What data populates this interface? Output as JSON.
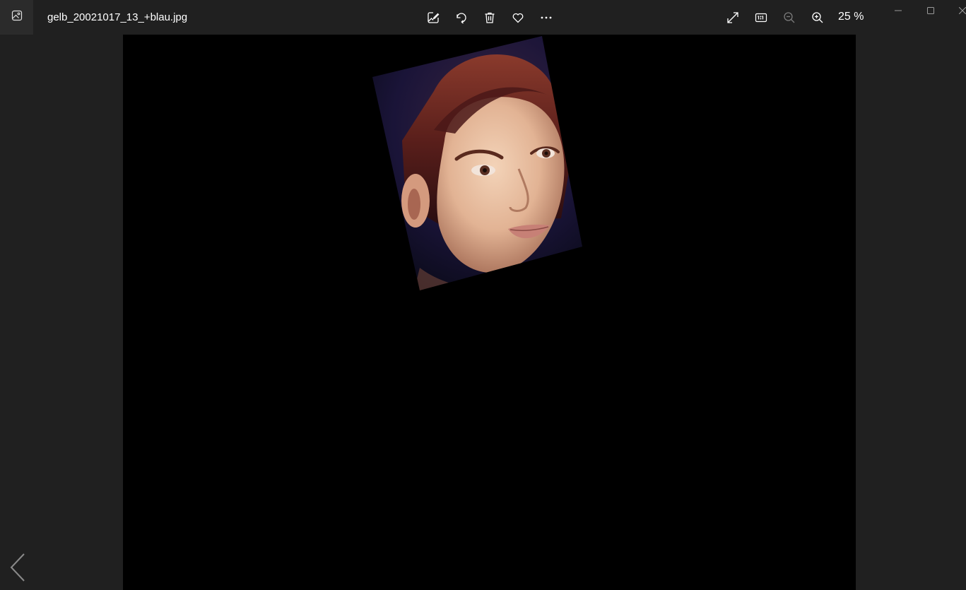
{
  "window": {
    "file_name": "gelb_20021017_13_+blau.jpg",
    "zoom_level": "25 %"
  },
  "toolbar": {
    "icons": [
      "edit-image-icon",
      "rotate-icon",
      "delete-icon",
      "favorite-icon",
      "more-icon"
    ]
  },
  "view_controls": {
    "icons": [
      "fullscreen-icon",
      "actual-size-icon",
      "zoom-out-icon",
      "zoom-in-icon"
    ]
  },
  "window_controls": {
    "icons": [
      "minimize-icon",
      "maximize-icon",
      "close-icon"
    ]
  },
  "navigation": {
    "icons": [
      "previous-arrow-icon"
    ]
  },
  "colors": {
    "chrome": "#202020",
    "canvas": "#000000",
    "icon": "#ffffff"
  }
}
